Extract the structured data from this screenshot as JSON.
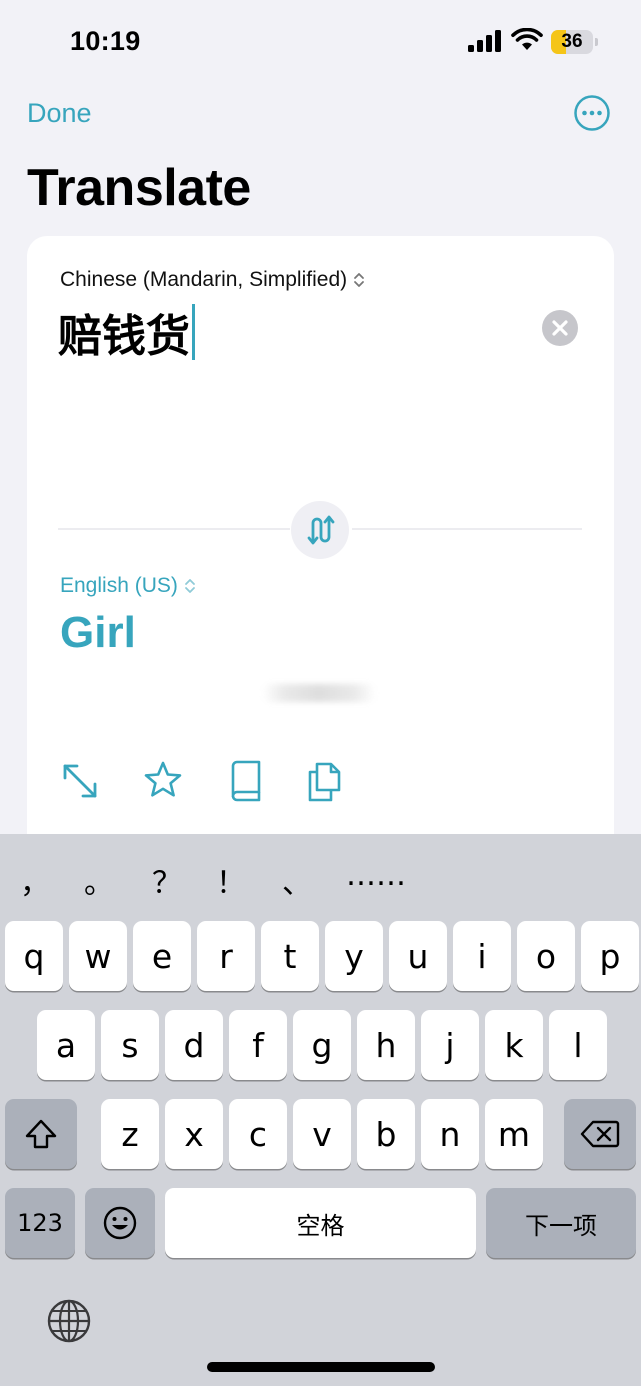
{
  "status_bar": {
    "time": "10:19",
    "battery": "36",
    "battery_level": 0.36
  },
  "nav": {
    "done_label": "Done",
    "more_icon": "ellipsis-circle-icon"
  },
  "page": {
    "title": "Translate"
  },
  "source": {
    "language": "Chinese (Mandarin, Simplified)",
    "text": "赔钱货"
  },
  "target": {
    "language": "English (US)",
    "text": "Girl"
  },
  "actions": [
    "expand-icon",
    "star-icon",
    "dictionary-book-icon",
    "copy-icon"
  ],
  "colors": {
    "accent": "#37a5bd",
    "background": "#f2f2f7",
    "card": "#ffffff",
    "keyboard": "#d1d3d9"
  },
  "keyboard": {
    "punctuation": [
      "，",
      "。",
      "？",
      "！",
      "、",
      "……"
    ],
    "row1": [
      "q",
      "w",
      "e",
      "r",
      "t",
      "y",
      "u",
      "i",
      "o",
      "p"
    ],
    "row2": [
      "a",
      "s",
      "d",
      "f",
      "g",
      "h",
      "j",
      "k",
      "l"
    ],
    "row3": [
      "z",
      "x",
      "c",
      "v",
      "b",
      "n",
      "m"
    ],
    "numbers_label": "123",
    "space_label": "空格",
    "next_label": "下一项"
  }
}
